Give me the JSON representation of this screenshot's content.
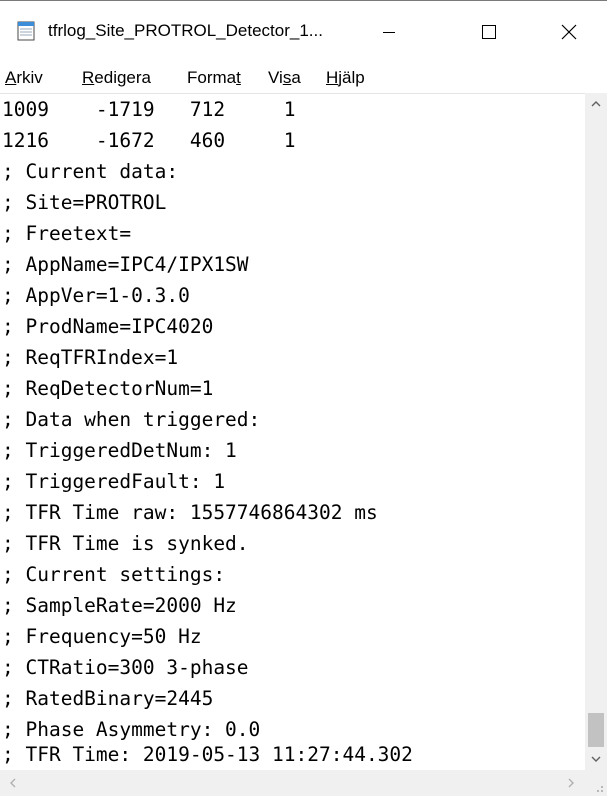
{
  "window": {
    "title": "tfrlog_Site_PROTROL_Detector_1...",
    "app_icon": "notepad-icon"
  },
  "titlebar_buttons": {
    "minimize_icon": "minimize-icon",
    "maximize_icon": "maximize-icon",
    "close_icon": "close-icon"
  },
  "menu": {
    "items": [
      {
        "pre": "",
        "key": "A",
        "post": "rkiv"
      },
      {
        "pre": "",
        "key": "R",
        "post": "edigera"
      },
      {
        "pre": "Forma",
        "key": "t",
        "post": ""
      },
      {
        "pre": "Vi",
        "key": "s",
        "post": "a"
      },
      {
        "pre": "",
        "key": "H",
        "post": "jälp"
      }
    ]
  },
  "editor": {
    "lines": [
      "1009    -1719   712     1",
      "1216    -1672   460     1",
      "; Current data:",
      "; Site=PROTROL",
      "; Freetext=",
      "; AppName=IPC4/IPX1SW",
      "; AppVer=1-0.3.0",
      "; ProdName=IPC4020",
      "; ReqTFRIndex=1",
      "; ReqDetectorNum=1",
      "; Data when triggered:",
      "; TriggeredDetNum: 1",
      "; TriggeredFault: 1",
      "; TFR Time raw: 1557746864302 ms",
      "; TFR Time is synked.",
      "; Current settings:",
      "; SampleRate=2000 Hz",
      "; Frequency=50 Hz",
      "; CTRatio=300 3-phase",
      "; RatedBinary=2445",
      "; Phase Asymmetry: 0.0",
      "; TFR Time: 2019-05-13 11:27:44.302"
    ]
  },
  "scrollbars": {
    "vertical_position": 0.95,
    "horizontal_position": 0.0
  },
  "colors": {
    "scrollbar_track": "#f0f0f0",
    "scrollbar_thumb": "#c2c2c2",
    "notepad_icon_blue": "#3c8ed8"
  }
}
